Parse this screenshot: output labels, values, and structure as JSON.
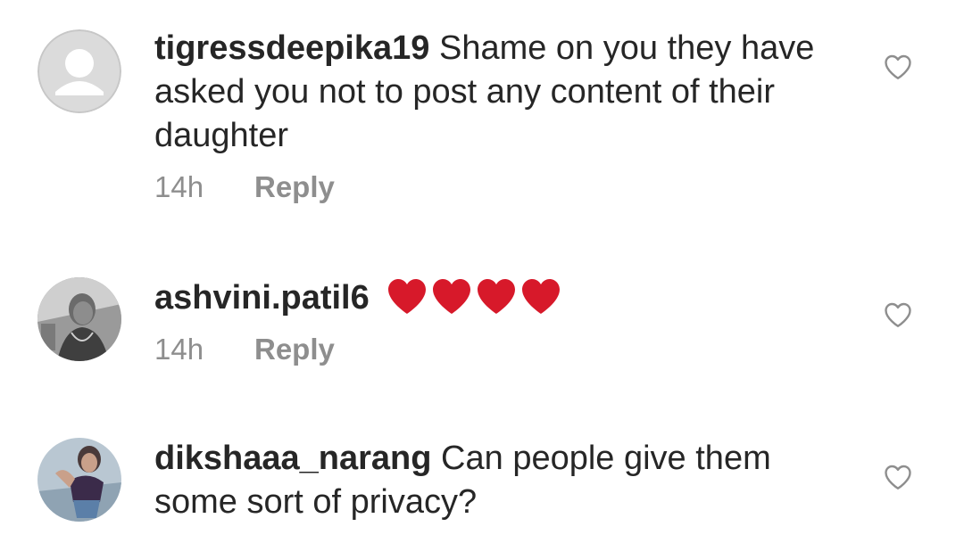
{
  "icons": {
    "like": "heart-outline-icon",
    "emoji": "red-heart-emoji"
  },
  "colors": {
    "username": "#262626",
    "meta": "#8e8e8e",
    "emoji_heart": "#d7192a"
  },
  "comments": [
    {
      "username": "tigressdeepika19",
      "text": "Shame on you they have asked you not to post any content of their daughter",
      "time": "14h",
      "reply_label": "Reply"
    },
    {
      "username": "ashvini.patil6",
      "emoji": "❤❤❤❤",
      "time": "14h",
      "reply_label": "Reply"
    },
    {
      "username": "dikshaaa_narang",
      "text": "Can people give them some sort of privacy?"
    }
  ]
}
